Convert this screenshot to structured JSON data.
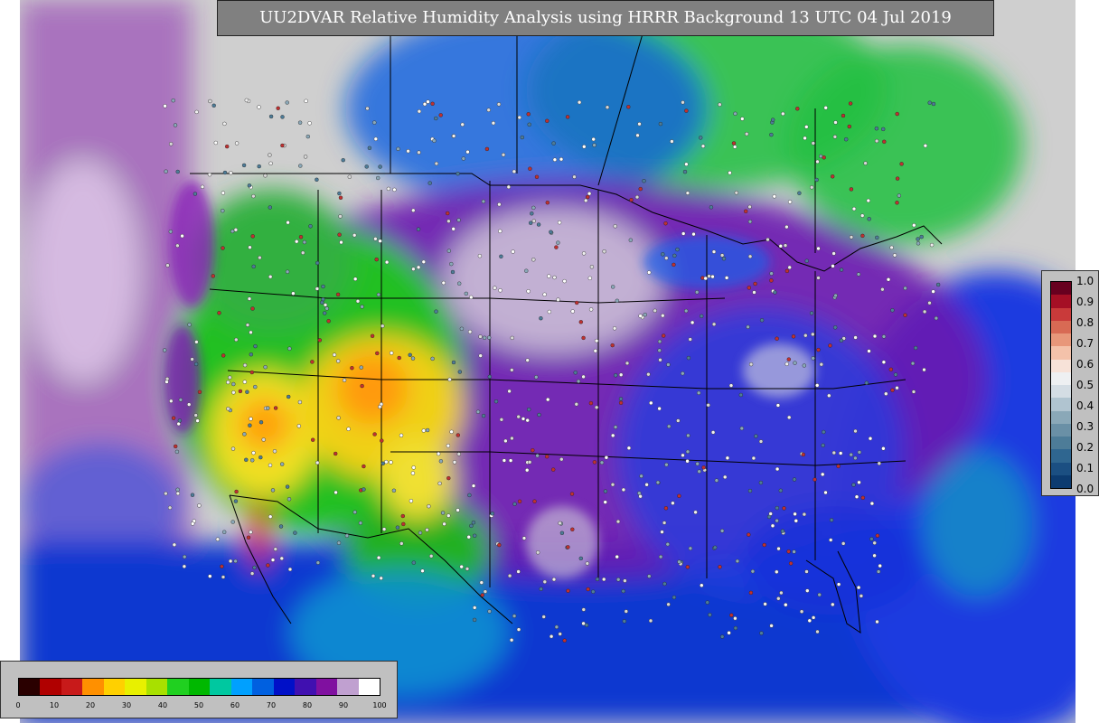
{
  "title": "UU2DVAR Relative Humidity Analysis using HRRR Background 13 UTC 04 Jul 2019",
  "humidity_legend": {
    "ticks": [
      "0",
      "10",
      "20",
      "30",
      "40",
      "50",
      "60",
      "70",
      "80",
      "90",
      "100"
    ],
    "colors": [
      "#2a0000",
      "#b00000",
      "#c81a1a",
      "#ff9000",
      "#ffd000",
      "#e8f000",
      "#a8e000",
      "#20d020",
      "#00b800",
      "#00c8a0",
      "#00a0ff",
      "#0060e0",
      "#0010c8",
      "#4010b0",
      "#8010a0",
      "#c0a0d0",
      "#ffffff"
    ]
  },
  "residual_legend": {
    "ticks": [
      "1.0",
      "0.9",
      "0.8",
      "0.7",
      "0.6",
      "0.5",
      "0.4",
      "0.3",
      "0.2",
      "0.1",
      "0.0"
    ],
    "colors": [
      "#67001f",
      "#a50f25",
      "#c93a3a",
      "#d86a54",
      "#e8977a",
      "#f4c2aa",
      "#f7e2d8",
      "#eef0f2",
      "#d4dde4",
      "#b0c4d0",
      "#8aa8b8",
      "#6a90a6",
      "#4d7c98",
      "#2f6690",
      "#1b4f82",
      "#0c3b70"
    ]
  },
  "map": {
    "background_color": "#d4d4d4",
    "ocean_color": "#1040d8",
    "dry_color": "#f0d020",
    "moist_color": "#20c040",
    "saturated_color": "#7010a0",
    "boundary_color": "#000000"
  }
}
